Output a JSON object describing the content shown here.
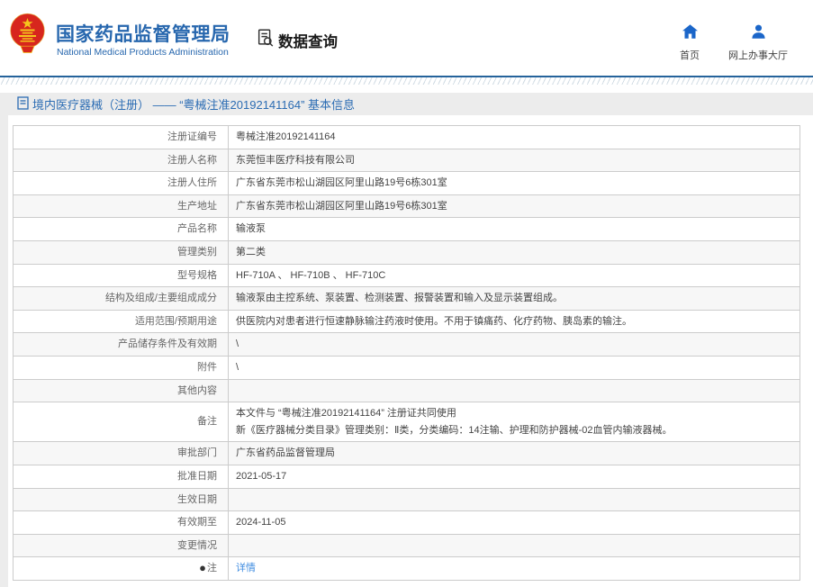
{
  "header": {
    "agency_title": "国家药品监督管理局",
    "agency_subtitle": "National Medical Products Administration",
    "section_label": "数据查询",
    "links": [
      {
        "icon": "home-icon",
        "label": "首页"
      },
      {
        "icon": "user-icon",
        "label": "网上办事大厅"
      }
    ]
  },
  "breadcrumb": "境内医疗器械（注册） —— “粤械注准20192141164” 基本信息",
  "table": {
    "rows": [
      {
        "label": "注册证编号",
        "value": "粤械注准20192141164"
      },
      {
        "label": "注册人名称",
        "value": "东莞恒丰医疗科技有限公司"
      },
      {
        "label": "注册人住所",
        "value": "广东省东莞市松山湖园区阿里山路19号6栋301室"
      },
      {
        "label": "生产地址",
        "value": "广东省东莞市松山湖园区阿里山路19号6栋301室"
      },
      {
        "label": "产品名称",
        "value": "输液泵"
      },
      {
        "label": "管理类别",
        "value": "第二类"
      },
      {
        "label": "型号规格",
        "value": "HF-710A 、 HF-710B 、 HF-710C"
      },
      {
        "label": "结构及组成/主要组成成分",
        "value": "输液泵由主控系统、泵装置、检测装置、报警装置和输入及显示装置组成。"
      },
      {
        "label": "适用范围/预期用途",
        "value": "供医院内对患者进行恒速静脉输注药液时使用。不用于镇痛药、化疗药物、胰岛素的输注。"
      },
      {
        "label": "产品储存条件及有效期",
        "value": "\\"
      },
      {
        "label": "附件",
        "value": "\\"
      },
      {
        "label": "其他内容",
        "value": ""
      },
      {
        "label": "备注",
        "value": "本文件与 “粤械注准20192141164” 注册证共同使用\n新《医疗器械分类目录》管理类别：Ⅱ类，分类编码：14注输、护理和防护器械-02血管内输液器械。"
      },
      {
        "label": "审批部门",
        "value": "广东省药品监督管理局"
      },
      {
        "label": "批准日期",
        "value": "2021-05-17"
      },
      {
        "label": "生效日期",
        "value": ""
      },
      {
        "label": "有效期至",
        "value": "2024-11-05"
      },
      {
        "label": "变更情况",
        "value": ""
      },
      {
        "label": "注",
        "label_icon": "note-bullet-icon",
        "value": "详情",
        "value_is_link": true
      }
    ]
  },
  "colors": {
    "brand_blue": "#2767ae",
    "icon_blue": "#1b66c9",
    "link_blue": "#3f8ce0",
    "bar_blue": "#25639b"
  }
}
